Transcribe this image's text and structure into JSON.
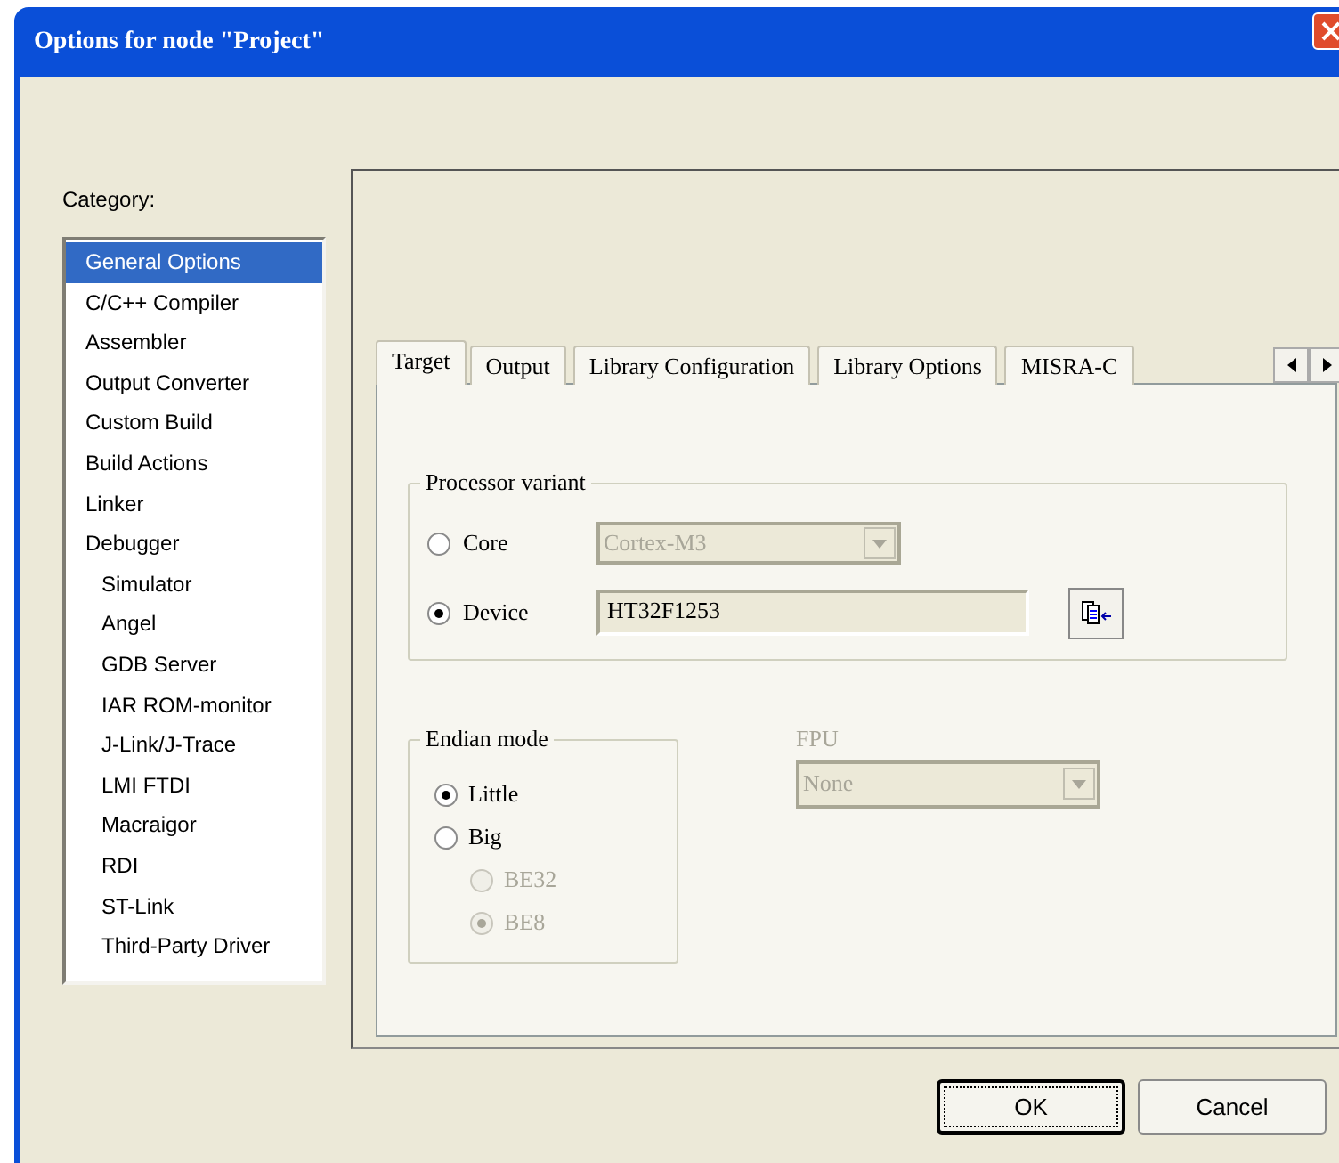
{
  "window": {
    "title": "Options for node \"Project\""
  },
  "category": {
    "label": "Category:",
    "items": [
      {
        "label": "General Options",
        "selected": true
      },
      {
        "label": "C/C++ Compiler",
        "selected": false
      },
      {
        "label": "Assembler",
        "selected": false
      },
      {
        "label": "Output Converter",
        "selected": false
      },
      {
        "label": "Custom Build",
        "selected": false
      },
      {
        "label": "Build Actions",
        "selected": false
      },
      {
        "label": "Linker",
        "selected": false
      },
      {
        "label": "Debugger",
        "selected": false,
        "children": [
          {
            "label": "Simulator",
            "selected": false
          },
          {
            "label": "Angel",
            "selected": false
          },
          {
            "label": "GDB Server",
            "selected": false
          },
          {
            "label": "IAR ROM-monitor",
            "selected": false
          },
          {
            "label": "J-Link/J-Trace",
            "selected": false
          },
          {
            "label": "LMI FTDI",
            "selected": false
          },
          {
            "label": "Macraigor",
            "selected": false
          },
          {
            "label": "RDI",
            "selected": false
          },
          {
            "label": "ST-Link",
            "selected": false
          },
          {
            "label": "Third-Party Driver",
            "selected": false
          }
        ]
      }
    ]
  },
  "tabs": [
    {
      "label": "Target",
      "selected": true
    },
    {
      "label": "Output",
      "selected": false
    },
    {
      "label": "Library Configuration",
      "selected": false
    },
    {
      "label": "Library Options",
      "selected": false
    },
    {
      "label": "MISRA-C",
      "selected": false
    }
  ],
  "processor_variant": {
    "title": "Processor variant",
    "options": [
      {
        "label": "Core",
        "selected": false,
        "kind": "combo",
        "value": "Cortex-M3",
        "disabled": true
      },
      {
        "label": "Device",
        "selected": true,
        "kind": "text",
        "value": "HT32F1253",
        "disabled": false
      }
    ]
  },
  "endian_mode": {
    "title": "Endian mode",
    "options": [
      {
        "label": "Little",
        "selected": true,
        "disabled": false
      },
      {
        "label": "Big",
        "selected": false,
        "disabled": false,
        "children": [
          {
            "label": "BE32",
            "selected": false,
            "disabled": true
          },
          {
            "label": "BE8",
            "selected": true,
            "disabled": true
          }
        ]
      }
    ]
  },
  "fpu": {
    "label": "FPU",
    "value": "None",
    "disabled": true
  },
  "buttons": [
    {
      "label": "OK",
      "default": true
    },
    {
      "label": "Cancel",
      "default": false
    }
  ]
}
